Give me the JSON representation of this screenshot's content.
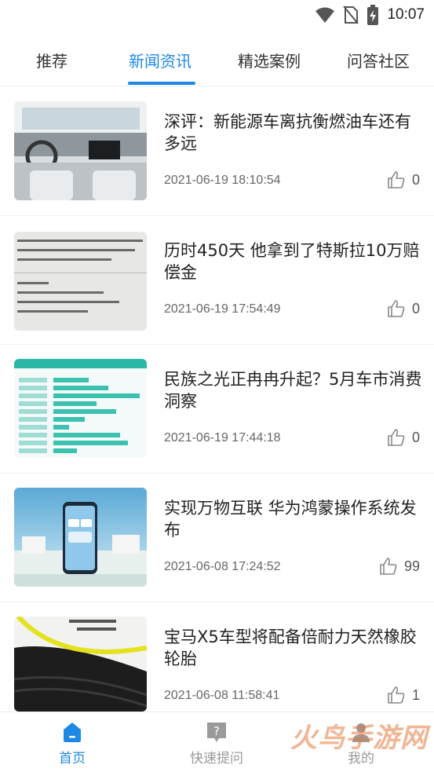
{
  "status_bar": {
    "time": "10:07"
  },
  "tabs": [
    {
      "label": "推荐"
    },
    {
      "label": "新闻资讯"
    },
    {
      "label": "精选案例"
    },
    {
      "label": "问答社区"
    }
  ],
  "news": [
    {
      "title": "深评：新能源车离抗衡燃油车还有多远",
      "date": "2021-06-19 18:10:54",
      "likes": "0",
      "thumb": "car-interior"
    },
    {
      "title": "历时450天 他拿到了特斯拉10万赔偿金",
      "date": "2021-06-19 17:54:49",
      "likes": "0",
      "thumb": "document-scan"
    },
    {
      "title": "民族之光正冉冉升起？5月车市消费洞察",
      "date": "2021-06-19 17:44:18",
      "likes": "0",
      "thumb": "bar-table"
    },
    {
      "title": "实现万物互联 华为鸿蒙操作系统发布",
      "date": "2021-06-08 17:24:52",
      "likes": "99",
      "thumb": "phone-expo"
    },
    {
      "title": "宝马X5车型将配备倍耐力天然橡胶轮胎",
      "date": "2021-06-08 11:58:41",
      "likes": "1",
      "thumb": "tire"
    }
  ],
  "bottom_nav": [
    {
      "label": "首页",
      "icon": "home-icon"
    },
    {
      "label": "快速提问",
      "icon": "question-icon"
    },
    {
      "label": "我的",
      "icon": "profile-icon"
    }
  ],
  "watermark": {
    "text": "火鸟手游网"
  },
  "colors": {
    "accent": "#1e88e5",
    "muted": "#999999"
  }
}
